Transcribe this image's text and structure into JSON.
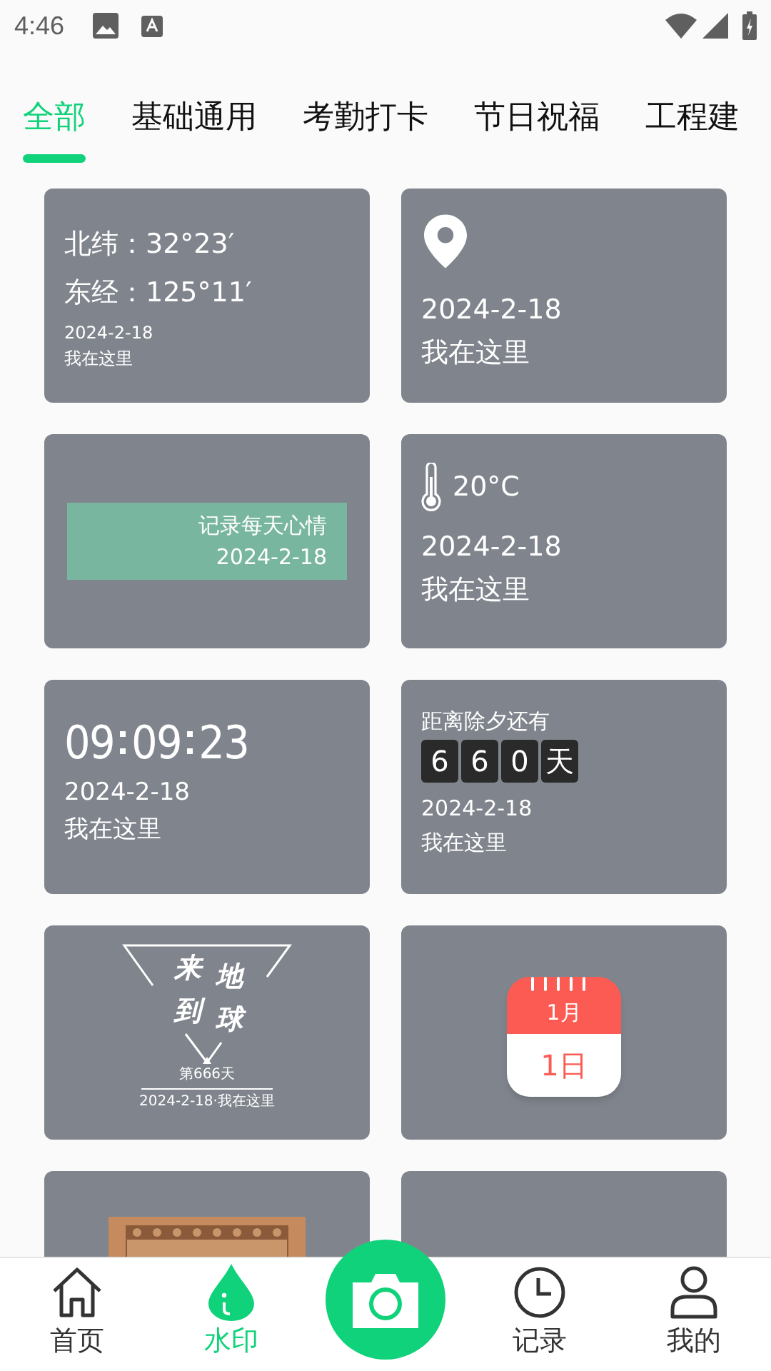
{
  "status_bar": {
    "time": "4:46"
  },
  "tabs": [
    {
      "label": "全部",
      "selected": true
    },
    {
      "label": "基础通用",
      "selected": false
    },
    {
      "label": "考勤打卡",
      "selected": false
    },
    {
      "label": "节日祝福",
      "selected": false
    },
    {
      "label": "工程建",
      "selected": false
    }
  ],
  "cards": [
    {
      "kind": "coords",
      "lines": [
        "北纬：32°23′",
        "东经：125°11′"
      ],
      "date": "2024-2-18",
      "place": "我在这里"
    },
    {
      "kind": "location",
      "date": "2024-2-18",
      "place": "我在这里"
    },
    {
      "kind": "mood",
      "text": "记录每天心情",
      "date": "2024-2-18"
    },
    {
      "kind": "weather",
      "temp": "20°C",
      "date": "2024-2-18",
      "place": "我在这里"
    },
    {
      "kind": "clock",
      "parts": [
        "09",
        "09",
        "23"
      ],
      "date": "2024-2-18",
      "place": "我在这里"
    },
    {
      "kind": "countdown",
      "caption": "距离除夕还有",
      "digits": [
        "6",
        "6",
        "0"
      ],
      "unit": "天",
      "date": "2024-2-18",
      "place": "我在这里"
    },
    {
      "kind": "earth",
      "chars": [
        "来",
        "地",
        "到",
        "球"
      ],
      "day": "第666天",
      "footer": "2024-2-18·我在这里"
    },
    {
      "kind": "calendar",
      "month": "1月",
      "day": "1日"
    },
    {
      "kind": "ticket"
    },
    {
      "kind": "blank"
    }
  ],
  "nav": [
    {
      "kind": "home",
      "label": "首页",
      "selected": false
    },
    {
      "kind": "watermark",
      "label": "水印",
      "selected": true
    },
    {
      "kind": "camera"
    },
    {
      "kind": "history",
      "label": "记录",
      "selected": false
    },
    {
      "kind": "profile",
      "label": "我的",
      "selected": false
    }
  ]
}
